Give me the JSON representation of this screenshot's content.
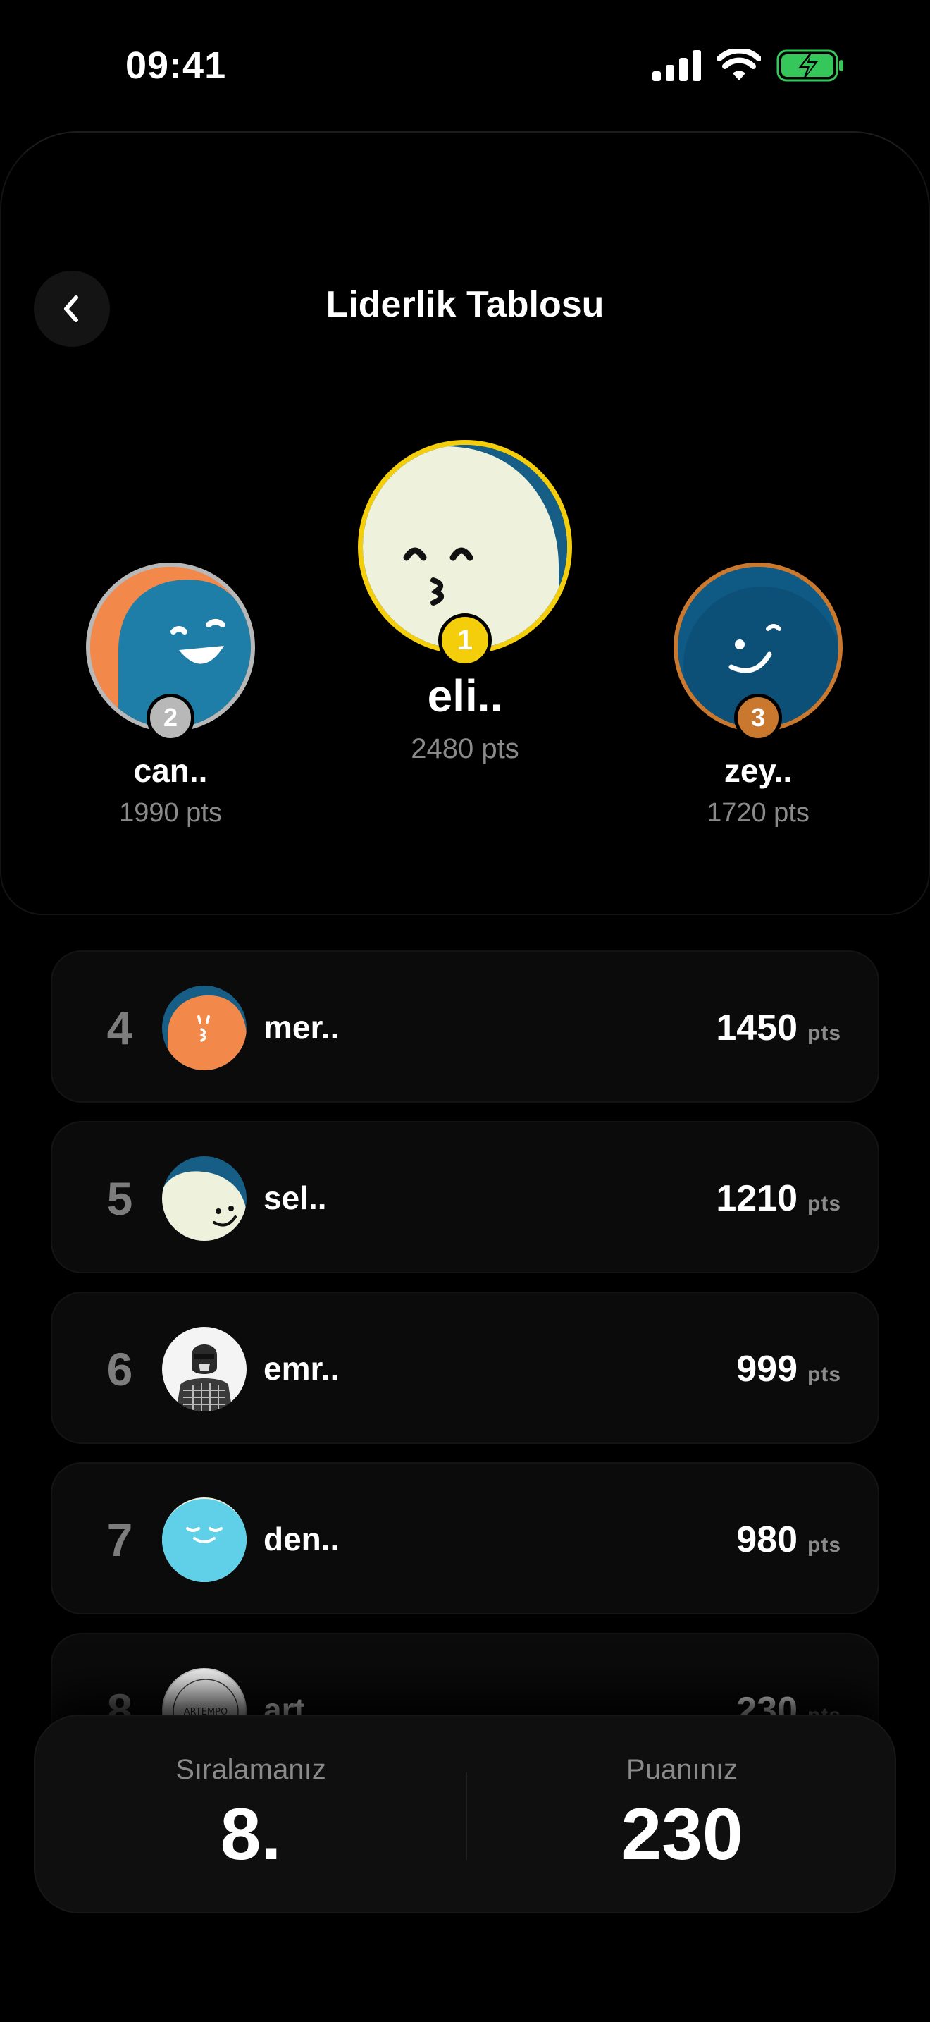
{
  "status_bar": {
    "time": "09:41"
  },
  "header": {
    "title": "Liderlik Tablosu"
  },
  "podium": {
    "first": {
      "rank": "1",
      "name": "eli..",
      "points": "2480 pts"
    },
    "second": {
      "rank": "2",
      "name": "can..",
      "points": "1990 pts"
    },
    "third": {
      "rank": "3",
      "name": "zey..",
      "points": "1720 pts"
    }
  },
  "leaderboard": [
    {
      "rank": "4",
      "name": "mer..",
      "points": "1450",
      "unit": "pts"
    },
    {
      "rank": "5",
      "name": "sel..",
      "points": "1210",
      "unit": "pts"
    },
    {
      "rank": "6",
      "name": "emr..",
      "points": "999",
      "unit": "pts"
    },
    {
      "rank": "7",
      "name": "den..",
      "points": "980",
      "unit": "pts"
    },
    {
      "rank": "8",
      "name": "art..",
      "points": "230",
      "unit": "pts",
      "avatar_text": "ARTEMPO"
    }
  ],
  "summary": {
    "rank_label": "Sıralamanız",
    "rank_value": "8.",
    "points_label": "Puanınız",
    "points_value": "230"
  },
  "colors": {
    "gold": "#F5CE0B",
    "silver": "#B8B8B8",
    "bronze": "#C9782E",
    "avatar_blue": "#1F7EA8",
    "avatar_orange": "#F2884A",
    "avatar_cream": "#EEF2DC",
    "avatar_cyan": "#5FD0E8",
    "battery_green": "#35C759"
  }
}
